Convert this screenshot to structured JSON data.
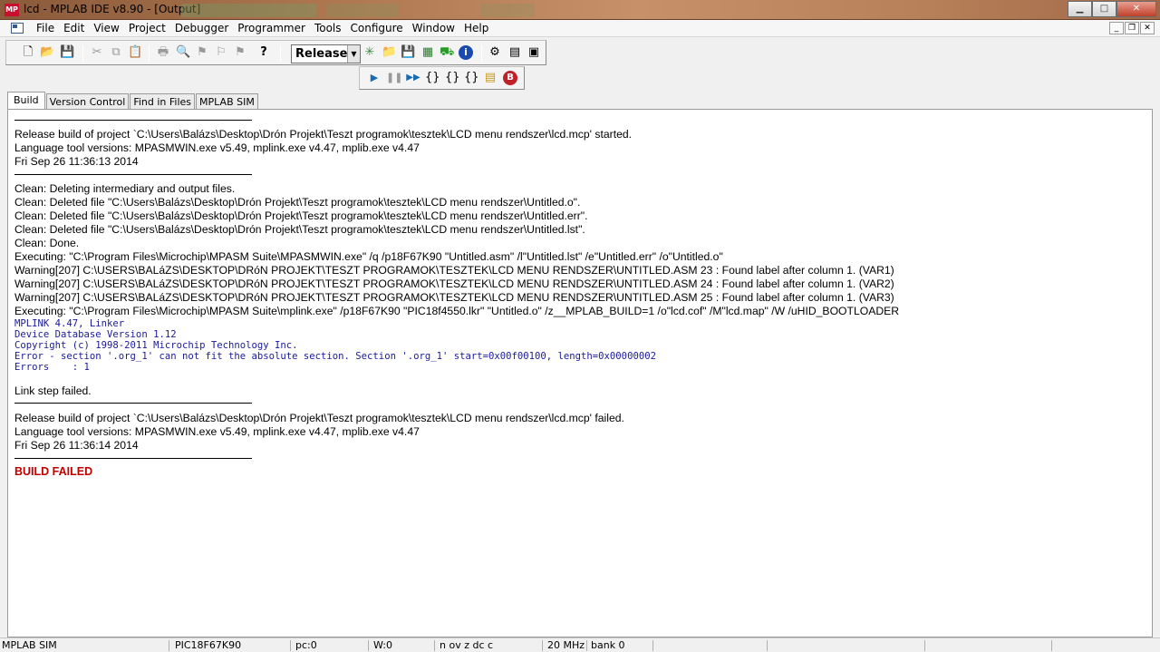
{
  "window": {
    "title": "lcd - MPLAB IDE v8.90 - [Output]",
    "logo_text": "MP",
    "controls": {
      "minimize": "▁",
      "maximize": "□",
      "close": "✕"
    }
  },
  "menubar": {
    "items": [
      "File",
      "Edit",
      "View",
      "Project",
      "Debugger",
      "Programmer",
      "Tools",
      "Configure",
      "Window",
      "Help"
    ],
    "mdi_controls": {
      "minimize": "_",
      "restore": "❐",
      "close": "✕"
    }
  },
  "toolbar": {
    "build_config": "Release",
    "icons_main": [
      "new-file-icon",
      "open-folder-icon",
      "save-icon",
      "cut-icon",
      "copy-icon",
      "paste-icon",
      "print-icon",
      "find-icon",
      "find-in-files-icon",
      "bookmark-icon",
      "bookmark-next-icon",
      "help-icon"
    ],
    "icons_project": [
      "new-project-icon",
      "open-project-icon",
      "save-project-icon",
      "build-icon",
      "make-icon",
      "info-icon",
      "checksum-icon",
      "memory-icon",
      "window-icon"
    ],
    "icons_debug": [
      "run-icon",
      "halt-icon",
      "animate-icon",
      "step-into-icon",
      "step-over-icon",
      "step-out-icon",
      "reset-icon",
      "breakpoint-icon"
    ]
  },
  "tabs": [
    "Build",
    "Version Control",
    "Find in Files",
    "MPLAB SIM"
  ],
  "active_tab": "Build",
  "output": {
    "lines": [
      "Release build of project `C:\\Users\\Balázs\\Desktop\\Drón Projekt\\Teszt programok\\tesztek\\LCD menu rendszer\\lcd.mcp' started.",
      "Language tool versions: MPASMWIN.exe v5.49, mplink.exe v4.47, mplib.exe v4.47",
      "Fri Sep 26 11:36:13 2014",
      "Clean: Deleting intermediary and output files.",
      "Clean: Deleted file \"C:\\Users\\Balázs\\Desktop\\Drón Projekt\\Teszt programok\\tesztek\\LCD menu rendszer\\Untitled.o\".",
      "Clean: Deleted file \"C:\\Users\\Balázs\\Desktop\\Drón Projekt\\Teszt programok\\tesztek\\LCD menu rendszer\\Untitled.err\".",
      "Clean: Deleted file \"C:\\Users\\Balázs\\Desktop\\Drón Projekt\\Teszt programok\\tesztek\\LCD menu rendszer\\Untitled.lst\".",
      "Clean: Done.",
      "Executing: \"C:\\Program Files\\Microchip\\MPASM Suite\\MPASMWIN.exe\" /q /p18F67K90 \"Untitled.asm\" /l\"Untitled.lst\" /e\"Untitled.err\" /o\"Untitled.o\"",
      "Warning[207] C:\\USERS\\BALáZS\\DESKTOP\\DRóN PROJEKT\\TESZT PROGRAMOK\\TESZTEK\\LCD MENU RENDSZER\\UNTITLED.ASM 23 : Found label after column 1. (VAR1)",
      "Warning[207] C:\\USERS\\BALáZS\\DESKTOP\\DRóN PROJEKT\\TESZT PROGRAMOK\\TESZTEK\\LCD MENU RENDSZER\\UNTITLED.ASM 24 : Found label after column 1. (VAR2)",
      "Warning[207] C:\\USERS\\BALáZS\\DESKTOP\\DRóN PROJEKT\\TESZT PROGRAMOK\\TESZTEK\\LCD MENU RENDSZER\\UNTITLED.ASM 25 : Found label after column 1. (VAR3)",
      "Executing: \"C:\\Program Files\\Microchip\\MPASM Suite\\mplink.exe\" /p18F67K90 \"PIC18f4550.lkr\" \"Untitled.o\" /z__MPLAB_BUILD=1 /o\"lcd.cof\" /M\"lcd.map\" /W /uHID_BOOTLOADER",
      "MPLINK 4.47, Linker",
      "Device Database Version 1.12",
      "Copyright (c) 1998-2011 Microchip Technology Inc.",
      "Error - section '.org_1' can not fit the absolute section. Section '.org_1' start=0x00f00100, length=0x00000002",
      "Errors    : 1",
      "Link step failed.",
      "Release build of project `C:\\Users\\Balázs\\Desktop\\Drón Projekt\\Teszt programok\\tesztek\\LCD menu rendszer\\lcd.mcp' failed.",
      "Language tool versions: MPASMWIN.exe v5.49, mplink.exe v4.47, mplib.exe v4.47",
      "Fri Sep 26 11:36:14 2014",
      "BUILD FAILED"
    ]
  },
  "statusbar": {
    "tool": "MPLAB SIM",
    "device": "PIC18F67K90",
    "pc": "pc:0",
    "w": "W:0",
    "flags": "n ov z dc c",
    "freq": "20 MHz",
    "bank": "bank 0"
  }
}
